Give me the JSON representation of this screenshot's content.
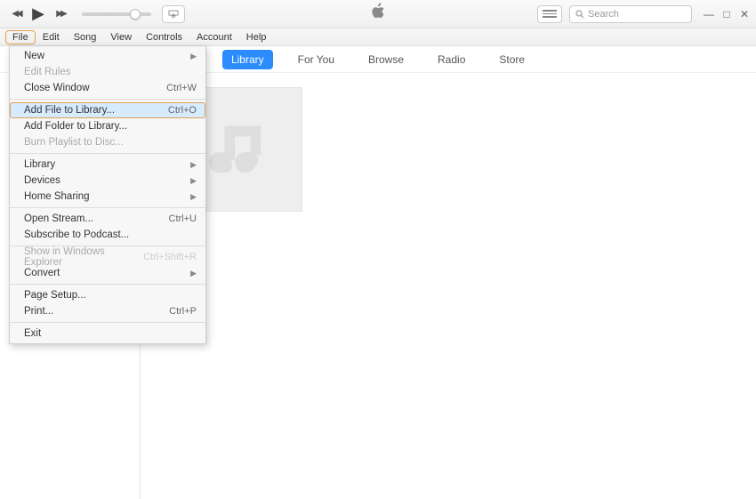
{
  "toolbar": {
    "search_placeholder": "Search"
  },
  "menubar": {
    "items": [
      "File",
      "Edit",
      "View",
      "Controls",
      "Account",
      "Help"
    ],
    "song": "Song"
  },
  "subnav": {
    "library": "Library",
    "for_you": "For You",
    "browse": "Browse",
    "radio": "Radio",
    "store": "Store"
  },
  "menu": {
    "new": "New",
    "edit_rules": "Edit Rules",
    "close_window": "Close Window",
    "close_window_sc": "Ctrl+W",
    "add_file": "Add File to Library...",
    "add_file_sc": "Ctrl+O",
    "add_folder": "Add Folder to Library...",
    "burn": "Burn Playlist to Disc...",
    "library": "Library",
    "devices": "Devices",
    "home_sharing": "Home Sharing",
    "open_stream": "Open Stream...",
    "open_stream_sc": "Ctrl+U",
    "subscribe": "Subscribe to Podcast...",
    "show_explorer": "Show in Windows Explorer",
    "show_explorer_sc": "Ctrl+Shift+R",
    "convert": "Convert",
    "page_setup": "Page Setup...",
    "print": "Print...",
    "print_sc": "Ctrl+P",
    "exit": "Exit"
  }
}
